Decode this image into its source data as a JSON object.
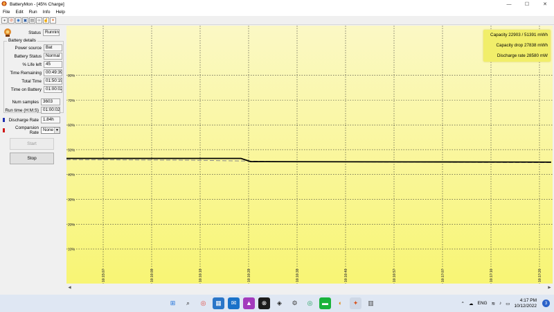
{
  "window": {
    "title": "BatteryMon - [45% Charge]",
    "controls": {
      "minimize": "—",
      "maximize": "☐",
      "close": "✕"
    }
  },
  "menu": [
    "File",
    "Edit",
    "Run",
    "Info",
    "Help"
  ],
  "toolbar": [
    {
      "icon": "stop-circle-icon",
      "glyph": "●",
      "color": "#7a7a7a"
    },
    {
      "icon": "no-entry-icon",
      "glyph": "⊘",
      "color": "#d14a23"
    },
    {
      "icon": "globe-icon",
      "glyph": "◉",
      "color": "#2f6fbf"
    },
    {
      "icon": "save-disk-icon",
      "glyph": "▣",
      "color": "#2f5fa5"
    },
    {
      "icon": "document-icon",
      "glyph": "▤",
      "color": "#555555"
    },
    {
      "icon": "link-icon",
      "glyph": "∞",
      "color": "#555555"
    },
    {
      "icon": "pointer-icon",
      "glyph": "☝",
      "color": "#555555"
    },
    {
      "icon": "battery-logo-icon",
      "glyph": "✦",
      "color": "#e0702a"
    }
  ],
  "panel": {
    "status": {
      "label": "Status",
      "value": "Running"
    },
    "battery_details_title": "Battery details",
    "details": [
      {
        "label": "Power source",
        "value": "Bat"
      },
      {
        "label": "Battery Status",
        "value": "Normal"
      },
      {
        "label": "% Life left",
        "value": "45"
      },
      {
        "label": "Time Remaining",
        "value": "00:49:39"
      },
      {
        "label": "Total Time",
        "value": "01:50:19"
      },
      {
        "label": "Time on Battery",
        "value": "01:00:02"
      }
    ],
    "num_samples": {
      "label": "Num samples",
      "value": "3603"
    },
    "run_time": {
      "label": "Run time (H:M:S)",
      "value": "01:00:02"
    },
    "discharge_rate": {
      "label": "Discharge Rate",
      "value": "1.84h",
      "color": "#1f2fb0"
    },
    "comparison_rate": {
      "label": "Comparsion Rate",
      "value": "None",
      "color": "#d01818"
    },
    "start_button": "Start",
    "stop_button": "Stop"
  },
  "chart_data": {
    "type": "line",
    "title": "",
    "xlabel": "",
    "ylabel": "",
    "ylim": [
      5,
      100
    ],
    "grid": true,
    "y_ticks": [
      "10%",
      "20%",
      "30%",
      "40%",
      "50%",
      "60%",
      "70%",
      "80%"
    ],
    "y_tick_values": [
      10,
      20,
      30,
      40,
      50,
      60,
      70,
      80
    ],
    "x_ticks": [
      "16:15:07",
      "16:16:08",
      "16:16:18",
      "16:16:28",
      "16:16:38",
      "16:16:48",
      "16:16:57",
      "16:17:07",
      "16:17:16",
      "16:17:26"
    ],
    "background_top": "#fbf8c5",
    "background_bottom": "#f8f574",
    "series": [
      {
        "color": "#000000",
        "dash": false,
        "points": [
          [
            0,
            46.5
          ],
          [
            3.6,
            46.5
          ],
          [
            3.8,
            45.2
          ],
          [
            7,
            45.1
          ],
          [
            10,
            45.0
          ]
        ]
      },
      {
        "color": "#888888",
        "dash": true,
        "points": [
          [
            0,
            46.0
          ],
          [
            2.5,
            45.8
          ],
          [
            4.5,
            45.2
          ],
          [
            7,
            45.0
          ],
          [
            10,
            44.8
          ]
        ]
      }
    ],
    "annotations": [
      "Capacity 22903 / 51391 mWh",
      "Capacity drop 27838 mWh",
      "Discharge rate 28580 mW"
    ]
  },
  "taskbar": {
    "apps": [
      {
        "icon": "windows-start-icon",
        "glyph": "⊞",
        "color": "#1b6fd8",
        "bg": "transparent"
      },
      {
        "icon": "search-icon",
        "glyph": "⌕",
        "color": "#222222",
        "bg": "transparent"
      },
      {
        "icon": "chrome-icon",
        "glyph": "◎",
        "color": "#e0443a",
        "bg": "transparent"
      },
      {
        "icon": "store-icon",
        "glyph": "▦",
        "color": "#ffffff",
        "bg": "#2b76c8"
      },
      {
        "icon": "mail-icon",
        "glyph": "✉",
        "color": "#ffffff",
        "bg": "#1a72c9"
      },
      {
        "icon": "photos-icon",
        "glyph": "▲",
        "color": "#ffffff",
        "bg": "#a33bbd"
      },
      {
        "icon": "xbox-icon",
        "glyph": "⊗",
        "color": "#ffffff",
        "bg": "#1c1c1c"
      },
      {
        "icon": "security-icon",
        "glyph": "◈",
        "color": "#222222",
        "bg": "transparent"
      },
      {
        "icon": "settings-gear-icon",
        "glyph": "⚙",
        "color": "#444444",
        "bg": "transparent"
      },
      {
        "icon": "chrome-alt-icon",
        "glyph": "◎",
        "color": "#1b9d5a",
        "bg": "transparent"
      },
      {
        "icon": "line-chat-icon",
        "glyph": "▬",
        "color": "#ffffff",
        "bg": "#19b33b"
      },
      {
        "icon": "zalo-icon",
        "glyph": "◐",
        "color": "#e08a1a",
        "bg": "transparent"
      },
      {
        "icon": "batterymon-taskbar-icon",
        "glyph": "✦",
        "color": "#d8521c",
        "bg": "#cfd8e6"
      },
      {
        "icon": "files-icon",
        "glyph": "▥",
        "color": "#444444",
        "bg": "transparent"
      }
    ],
    "tray": {
      "chevron": "⌃",
      "cloud": "☁",
      "language": "ENG",
      "wifi": "≋",
      "volume": "♪",
      "battery": "▭",
      "time": "4:17 PM",
      "date": "10/12/2022",
      "notifications": "3"
    }
  }
}
